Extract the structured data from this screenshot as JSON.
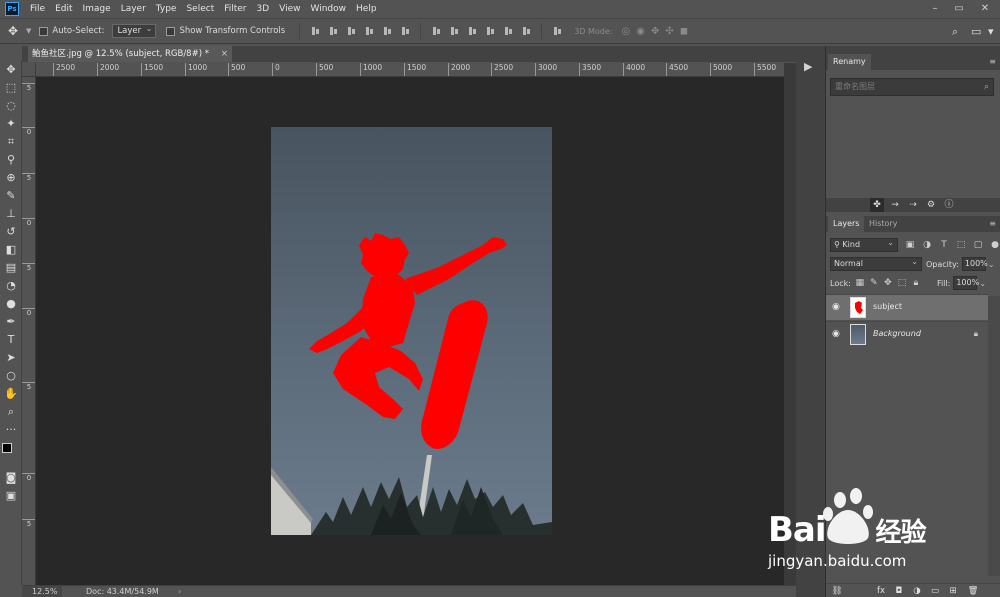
{
  "app": {
    "logo": "Ps",
    "menu": [
      "File",
      "Edit",
      "Image",
      "Layer",
      "Type",
      "Select",
      "Filter",
      "3D",
      "View",
      "Window",
      "Help"
    ],
    "window_controls": [
      "–",
      "▭",
      "✕"
    ]
  },
  "options": {
    "auto_select_label": "Auto-Select:",
    "auto_select_target": "Layer",
    "show_transform_label": "Show Transform Controls",
    "mode_3d_label": "3D Mode:"
  },
  "document": {
    "tab_title": "鲐鱼社区.jpg @ 12.5% (subject, RGB/8#) *",
    "close": "×"
  },
  "rulers": {
    "top_labels": [
      "2500",
      "2000",
      "1500",
      "1000",
      "500",
      "0",
      "500",
      "1000",
      "1500",
      "2000",
      "2500",
      "3000",
      "3500",
      "4000",
      "4500",
      "5000",
      "5500"
    ],
    "left_labels": [
      "5",
      "0",
      "5",
      "0",
      "5",
      "0",
      "5",
      "0",
      "5"
    ]
  },
  "status": {
    "zoom": "12.5%",
    "doc_size": "Doc: 43.4M/54.9M",
    "arrow": "›"
  },
  "renamy": {
    "tab": "Renamy",
    "placeholder": "重命名图层"
  },
  "layers_panel": {
    "tabs": [
      "Layers",
      "History"
    ],
    "kind_filter": "Kind",
    "blend_mode": "Normal",
    "opacity_label": "Opacity:",
    "opacity_value": "100%",
    "lock_label": "Lock:",
    "fill_label": "Fill:",
    "fill_value": "100%",
    "layers": [
      {
        "name": "subject",
        "selected": true
      },
      {
        "name": "Background",
        "locked": true
      }
    ]
  },
  "watermark": {
    "brand_left": "Bai",
    "brand_right": "经验",
    "url": "jingyan.baidu.com"
  },
  "colors": {
    "subject_red": "#ff0000",
    "sky_top": "#4a5764",
    "sky_bottom": "#69798a",
    "canvas_bg": "#282828",
    "ui_gray": "#535353"
  }
}
